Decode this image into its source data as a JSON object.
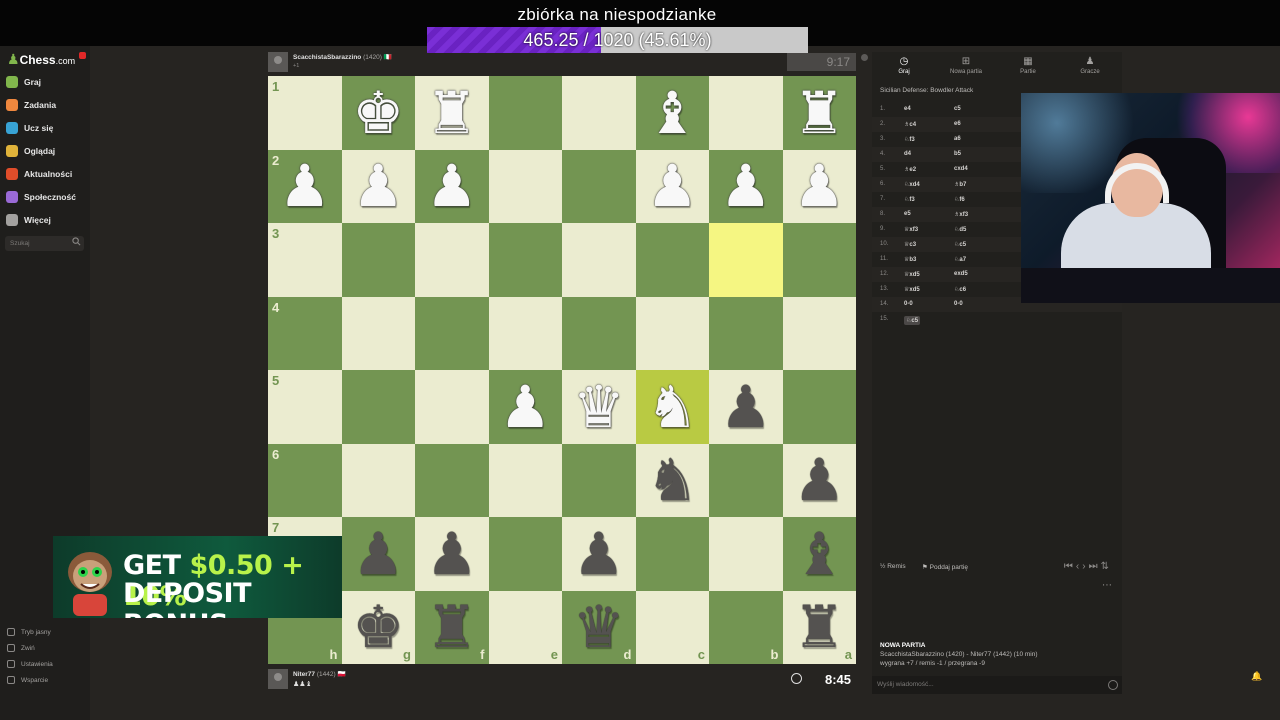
{
  "stream": {
    "donation_title": "zbiórka na niespodzianke",
    "donation_progress": "465.25 / 1020 (45.61%)",
    "donation_fraction": 0.4561
  },
  "sidebar": {
    "logo": "Chess",
    "logo_suffix": ".com",
    "items": [
      {
        "label": "Graj",
        "icon": "play-icon",
        "color": "#81b64c"
      },
      {
        "label": "Zadania",
        "icon": "puzzle-icon",
        "color": "#f0883e"
      },
      {
        "label": "Ucz się",
        "icon": "learn-icon",
        "color": "#38a3d4"
      },
      {
        "label": "Oglądaj",
        "icon": "watch-icon",
        "color": "#e0b33a"
      },
      {
        "label": "Aktualności",
        "icon": "news-icon",
        "color": "#e04d2a"
      },
      {
        "label": "Społeczność",
        "icon": "social-icon",
        "color": "#9a6ad6"
      },
      {
        "label": "Więcej",
        "icon": "more-icon",
        "color": "#a3a19f"
      }
    ],
    "search_placeholder": "Szukaj",
    "bottom_items": [
      "Tryb jasny",
      "Zwiń",
      "Ustawienia",
      "Wsparcie"
    ]
  },
  "top_player": {
    "name": "ScacchistaSbarazzino",
    "rating": "(1420)",
    "flag": "🇮🇹",
    "captured": "+1"
  },
  "top_clock": "9:17",
  "bottom_player": {
    "name": "Niter77",
    "rating": "(1442)",
    "flag": "🇵🇱",
    "captured": "♟♟♝"
  },
  "bottom_clock": "8:45",
  "board": {
    "ranks": [
      "1",
      "2",
      "3",
      "4",
      "5",
      "6",
      "7",
      "8"
    ],
    "files": [
      "h",
      "g",
      "f",
      "e",
      "d",
      "c",
      "b",
      "a"
    ],
    "pieces": [
      [
        "",
        "♚",
        "♜",
        "",
        "",
        "♝",
        "",
        "♜"
      ],
      [
        "♟",
        "♟",
        "♟",
        "",
        "",
        "♟",
        "♟",
        "♟"
      ],
      [
        "",
        "",
        "",
        "",
        "",
        "",
        "",
        ""
      ],
      [
        "",
        "",
        "",
        "",
        "",
        "",
        "",
        ""
      ],
      [
        "",
        "",
        "",
        "♟",
        "♛",
        "♞",
        "b♟",
        ""
      ],
      [
        "",
        "",
        "",
        "",
        "",
        "b♞",
        "",
        "b♟"
      ],
      [
        "",
        "b♟",
        "b♟",
        "",
        "b♟",
        "",
        "",
        "b♝"
      ],
      [
        "",
        "b♚",
        "b♜",
        "",
        "b♛",
        "",
        "",
        "b♜"
      ]
    ],
    "highlights": [
      "b3",
      "c5"
    ]
  },
  "ad": {
    "line1_prefix": "GET ",
    "line1_accent": "$0.50 + 10%",
    "line2": "DEPOSIT BONUS"
  },
  "panel": {
    "tabs": [
      {
        "label": "Graj",
        "icon": "clock-icon"
      },
      {
        "label": "Nowa partia",
        "icon": "plus-icon"
      },
      {
        "label": "Partie",
        "icon": "games-icon"
      },
      {
        "label": "Gracze",
        "icon": "players-icon"
      }
    ],
    "opening": "Sicilian Defense: Bowdler Attack",
    "moves": [
      {
        "n": "1.",
        "w": "e4",
        "b": "c5"
      },
      {
        "n": "2.",
        "w": "♗c4",
        "b": "e6"
      },
      {
        "n": "3.",
        "w": "♘f3",
        "b": "a6"
      },
      {
        "n": "4.",
        "w": "d4",
        "b": "b5"
      },
      {
        "n": "5.",
        "w": "♗e2",
        "b": "cxd4"
      },
      {
        "n": "6.",
        "w": "♘xd4",
        "b": "♗b7"
      },
      {
        "n": "7.",
        "w": "♘f3",
        "b": "♘f6"
      },
      {
        "n": "8.",
        "w": "e5",
        "b": "♗xf3"
      },
      {
        "n": "9.",
        "w": "♕xf3",
        "b": "♘d5"
      },
      {
        "n": "10.",
        "w": "♕c3",
        "b": "♘c5"
      },
      {
        "n": "11.",
        "w": "♕b3",
        "b": "♘a7"
      },
      {
        "n": "12.",
        "w": "♕xd5",
        "b": "exd5"
      },
      {
        "n": "13.",
        "w": "♕xd5",
        "b": "♘c6"
      },
      {
        "n": "14.",
        "w": "0-0",
        "b": "0-0"
      },
      {
        "n": "15.",
        "w": "♘c5",
        "b": ""
      }
    ],
    "draw_label": "Remis",
    "resign_label": "Poddaj partię",
    "new_game_heading": "NOWA PARTIA",
    "new_game_players": "ScacchistaSbarazzino (1420) - Niter77 (1442) (10 min)",
    "new_game_stats": "wygrana +7 / remis -1 / przegrana -9",
    "chat_placeholder": "Wyślij wiadomość..."
  }
}
